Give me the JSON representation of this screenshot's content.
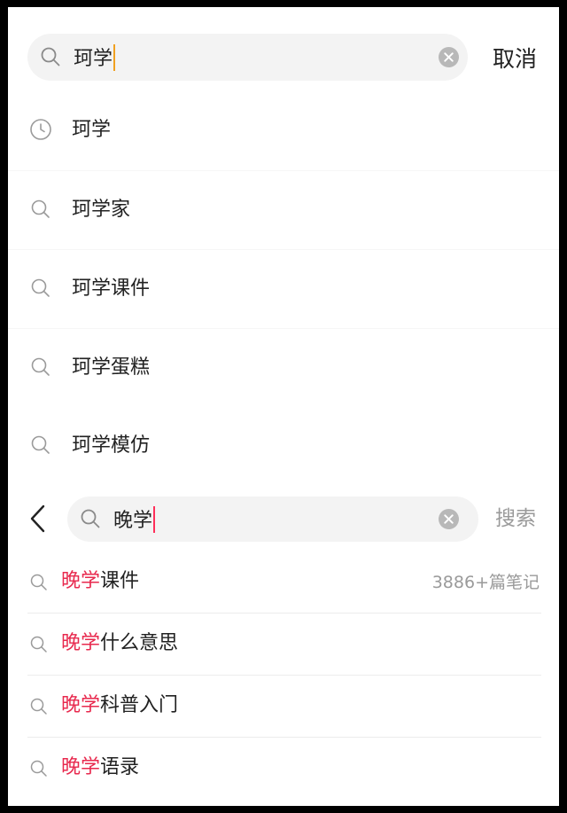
{
  "top": {
    "search_query": "珂学",
    "cancel_label": "取消",
    "suggestions": [
      {
        "icon": "clock-icon",
        "text": "珂学"
      },
      {
        "icon": "search-icon",
        "text": "珂学家"
      },
      {
        "icon": "search-icon",
        "text": "珂学课件"
      },
      {
        "icon": "search-icon",
        "text": "珂学蛋糕"
      },
      {
        "icon": "search-icon",
        "text": "珂学模仿"
      }
    ]
  },
  "bottom": {
    "search_query": "晚学",
    "submit_label": "搜索",
    "suggestions": [
      {
        "highlight": "晚学",
        "rest": "课件",
        "count": "3886+篇笔记"
      },
      {
        "highlight": "晚学",
        "rest": "什么意思"
      },
      {
        "highlight": "晚学",
        "rest": "科普入门"
      },
      {
        "highlight": "晚学",
        "rest": "语录"
      }
    ]
  },
  "colors": {
    "highlight": "#e8294e",
    "top_caret": "#f0a020",
    "bottom_caret": "#ff2f5a",
    "search_bg": "#f3f3f3",
    "muted_text": "#9a9a9a"
  }
}
